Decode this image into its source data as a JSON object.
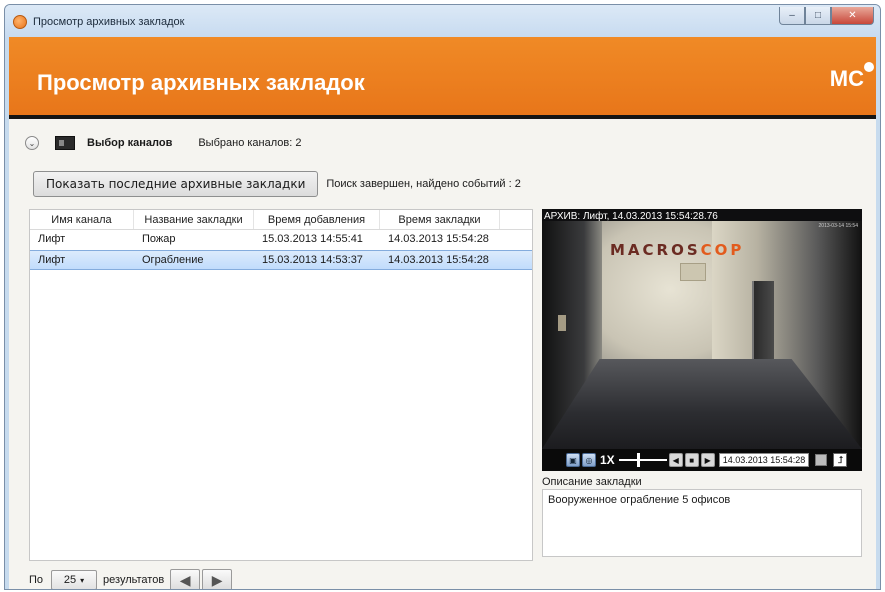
{
  "window": {
    "title": "Просмотр архивных закладок",
    "buttons": {
      "minimize": "–",
      "maximize": "□",
      "close": "✕"
    }
  },
  "header": {
    "title": "Просмотр архивных закладок",
    "logo": "MC"
  },
  "channel_selector": {
    "expand_icon": "⌄",
    "label": "Выбор каналов",
    "selected_count": "Выбрано каналов:  2"
  },
  "toolbar": {
    "show_button": "Показать последние архивные закладки",
    "status": "Поиск завершен, найдено событий : 2"
  },
  "table": {
    "columns": [
      "Имя канала",
      "Название закладки",
      "Время добавления",
      "Время закладки"
    ],
    "rows": [
      [
        "Лифт",
        "Пожар",
        "15.03.2013 14:55:41",
        "14.03.2013 15:54:28"
      ],
      [
        "Лифт",
        "Ограбление",
        "15.03.2013 14:53:37",
        "14.03.2013 15:54:28"
      ]
    ],
    "selected_row": 1
  },
  "video": {
    "caption": "АРХИВ: Лифт, 14.03.2013 15:54:28.76",
    "stamp": "2013-03-14 15:54",
    "sign_dark": "MACROS",
    "sign_light": "COP",
    "controls": {
      "speed": "1X",
      "time": "14.03.2013 15:54:28",
      "prev_icon": "◀",
      "stop_icon": "■",
      "play_icon": "▶",
      "exit_icon": "⮥"
    }
  },
  "description": {
    "label": "Описание закладки",
    "text": "Вооруженное ограбление 5 офисов"
  },
  "pager": {
    "prefix": "По",
    "page_size": "25",
    "caret": "▾",
    "suffix": "результатов",
    "prev_icon": "◀",
    "next_icon": "▶"
  }
}
